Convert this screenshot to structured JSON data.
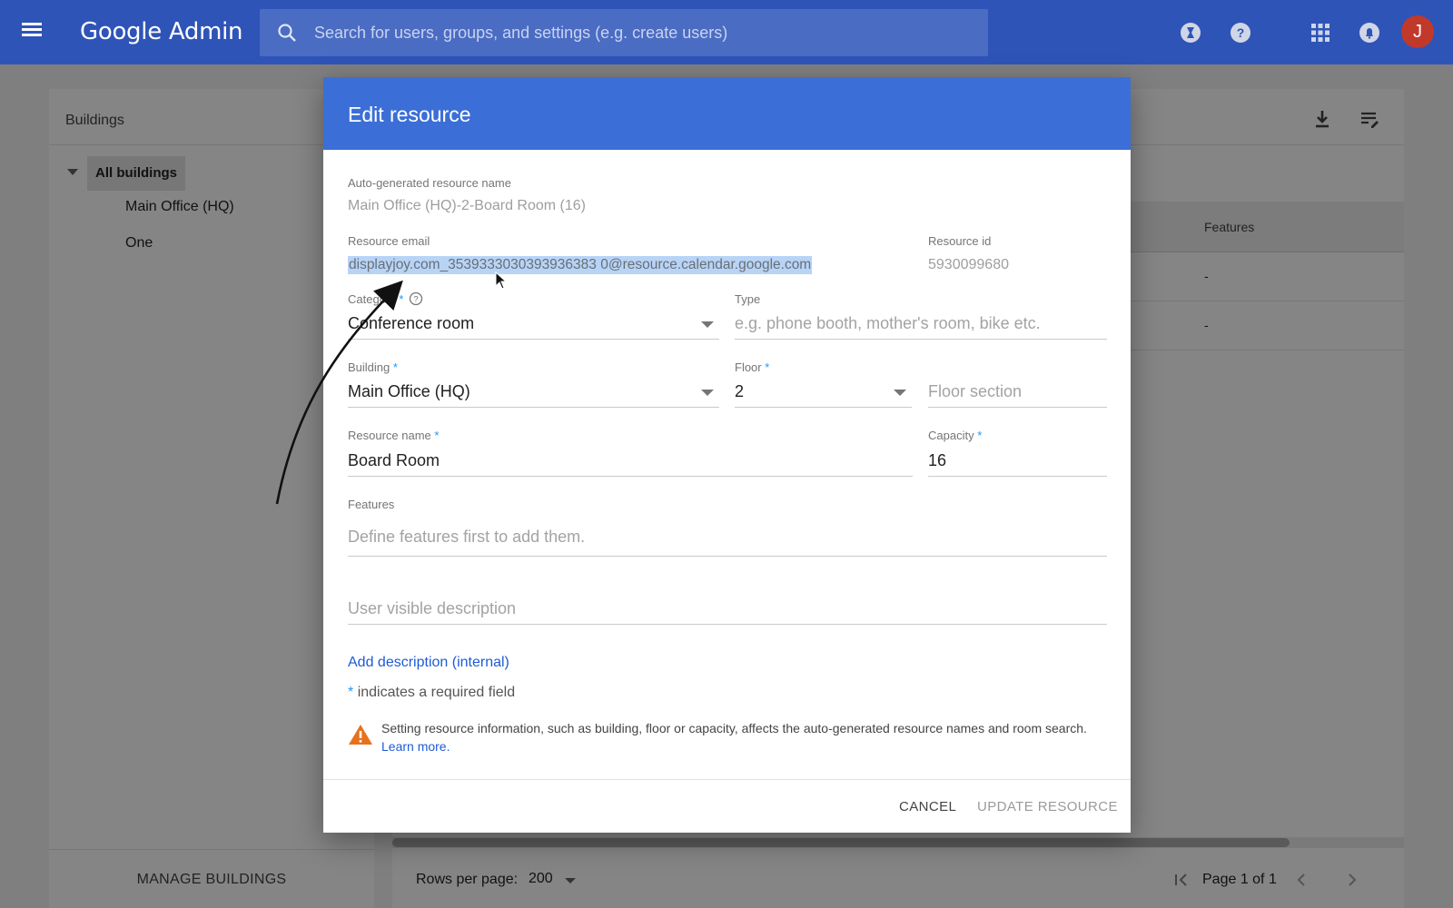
{
  "topbar": {
    "brand_main": "Google",
    "brand_sub": "Admin",
    "search_placeholder": "Search for users, groups, and settings (e.g. create users)",
    "avatar_letter": "J"
  },
  "left_panel": {
    "header": "Buildings",
    "tree": {
      "root": "All buildings",
      "children": [
        "Main Office (HQ)",
        "One"
      ]
    },
    "manage_button": "MANAGE BUILDINGS"
  },
  "table": {
    "visible_column": "Features",
    "rows": [
      {
        "features": "-"
      },
      {
        "features": "-"
      }
    ]
  },
  "pager": {
    "rows_per_page_label": "Rows per page:",
    "rows_per_page_value": "200",
    "page_text": "Page 1 of 1"
  },
  "dialog": {
    "title": "Edit resource",
    "auto_name_label": "Auto-generated resource name",
    "auto_name_value": "Main Office (HQ)-2-Board Room (16)",
    "email_label": "Resource email",
    "email_value": "displayjoy.com_3539333030393936383 0@resource.calendar.google.com",
    "resource_id_label": "Resource id",
    "resource_id_value": "5930099680",
    "category_label": "Category",
    "category_value": "Conference room",
    "type_label": "Type",
    "type_placeholder": "e.g. phone booth, mother's room, bike etc.",
    "building_label": "Building",
    "building_value": "Main Office (HQ)",
    "floor_label": "Floor",
    "floor_value": "2",
    "floor_section_placeholder": "Floor section",
    "resource_name_label": "Resource name",
    "resource_name_value": "Board Room",
    "capacity_label": "Capacity",
    "capacity_value": "16",
    "features_label": "Features",
    "features_placeholder": "Define features first to add them.",
    "description_placeholder": "User visible description",
    "add_description_link": "Add description (internal)",
    "required_note": "indicates a required field",
    "required_star": "*",
    "warning_text": "Setting resource information, such as building, floor or capacity, affects the auto-generated resource names and room search.",
    "warning_link": "Learn more.",
    "cancel_button": "CANCEL",
    "update_button": "UPDATE RESOURCE"
  },
  "colors": {
    "topbar": "#2f54b8",
    "dialog_header": "#3b6fd7",
    "selection": "#b7d4f7",
    "link": "#1e5bd8",
    "warning": "#e8711c",
    "avatar": "#c0392b"
  }
}
